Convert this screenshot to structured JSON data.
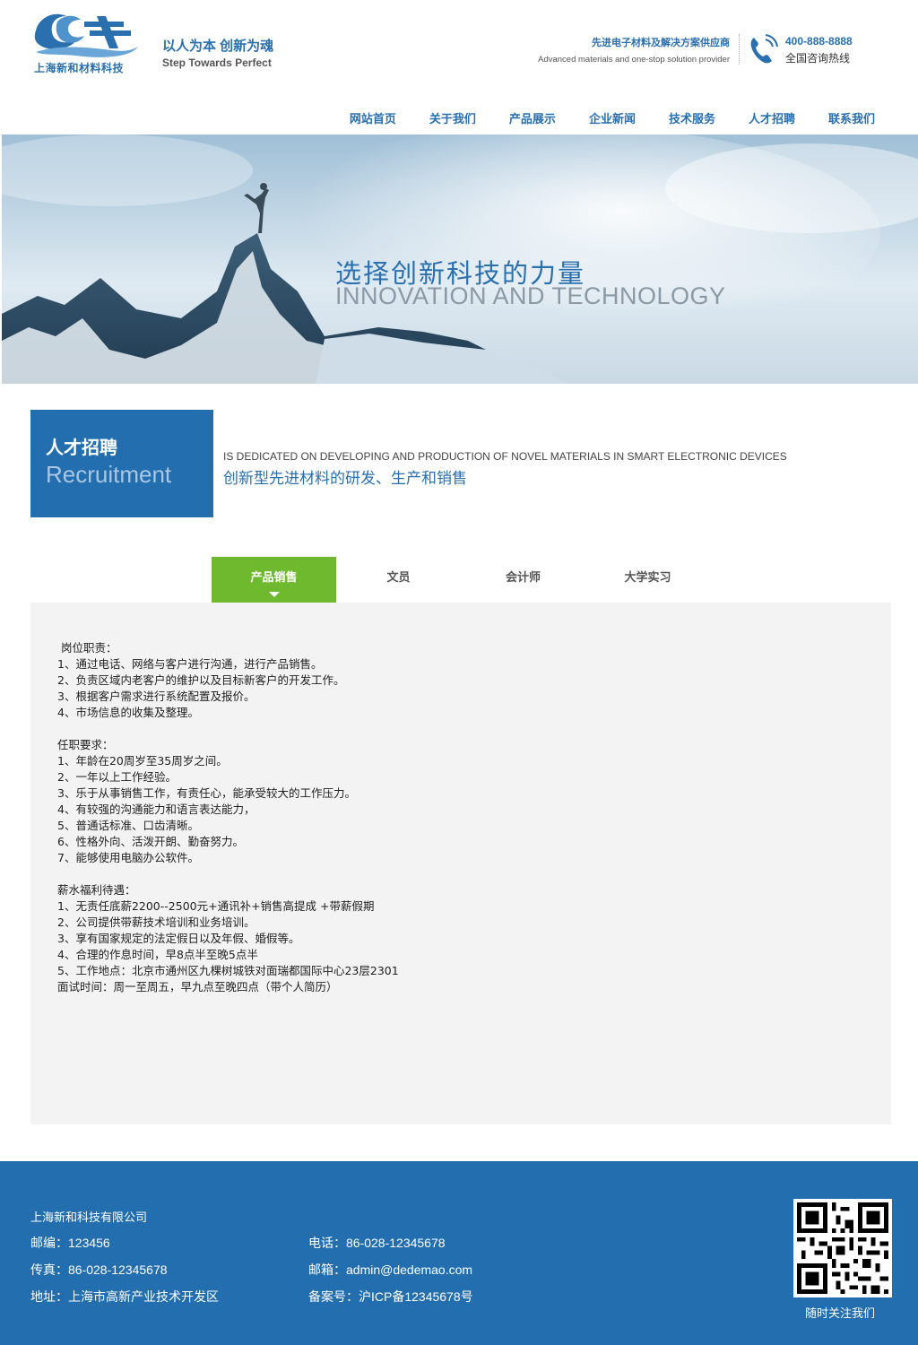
{
  "header": {
    "logo_text": "上海新和材料科技",
    "slogan_cn": "以人为本 创新为魂",
    "slogan_en": "Step Towards Perfect",
    "tagline_cn": "先进电子材料及解决方案供应商",
    "tagline_en": "Advanced materials and one-stop solution provider",
    "hotline_number": "400-888-8888",
    "hotline_label": "全国咨询热线"
  },
  "nav": {
    "items": [
      {
        "label": "网站首页"
      },
      {
        "label": "关于我们"
      },
      {
        "label": "产品展示"
      },
      {
        "label": "企业新闻"
      },
      {
        "label": "技术服务"
      },
      {
        "label": "人才招聘"
      },
      {
        "label": "联系我们"
      }
    ]
  },
  "banner": {
    "title_cn": "选择创新科技的力量",
    "title_en": "INNOVATION AND TECHNOLOGY"
  },
  "section": {
    "title_cn": "人才招聘",
    "title_en": "Recruitment",
    "desc_en": "IS DEDICATED ON DEVELOPING AND PRODUCTION OF NOVEL MATERIALS IN SMART ELECTRONIC DEVICES",
    "desc_cn": "创新型先进材料的研发、生产和销售"
  },
  "tabs": [
    {
      "label": "产品销售",
      "active": true
    },
    {
      "label": "文员",
      "active": false
    },
    {
      "label": "会计师",
      "active": false
    },
    {
      "label": "大学实习",
      "active": false
    }
  ],
  "content": {
    "duty_title": " 岗位职责：",
    "duties": [
      "1、通过电话、网络与客户进行沟通，进行产品销售。",
      "2、负责区域内老客户的维护以及目标新客户的开发工作。",
      "3、根据客户需求进行系统配置及报价。",
      "4、市场信息的收集及整理。"
    ],
    "req_title": "任职要求：",
    "requirements": [
      "1、年龄在20周岁至35周岁之间。",
      "2、一年以上工作经验。",
      "3、乐于从事销售工作，有责任心，能承受较大的工作压力。",
      "4、有较强的沟通能力和语言表达能力，",
      "5、普通话标准、口齿清晰。",
      "6、性格外向、活泼开朗、勤奋努力。",
      "7、能够使用电脑办公软件。"
    ],
    "benefit_title": "薪水福利待遇：",
    "benefits": [
      "1、无责任底薪2200--2500元+通讯补+销售高提成 +带薪假期",
      "2、公司提供带薪技术培训和业务培训。",
      "3、享有国家规定的法定假日以及年假、婚假等。",
      "4、合理的作息时间，早8点半至晚5点半",
      "5、工作地点：北京市通州区九棵树城铁对面瑞都国际中心23层2301",
      "面试时间：周一至周五，早九点至晚四点（带个人简历）"
    ]
  },
  "footer": {
    "company": "上海新和科技有限公司",
    "postcode": "邮编：123456",
    "phone": "电话：86-028-12345678",
    "fax": "传真：86-028-12345678",
    "email": "邮箱：admin@dedemao.com",
    "address": "地址：上海市高新产业技术开发区",
    "icp": "备案号：沪ICP备12345678号",
    "qr_label": "随时关注我们"
  },
  "colors": {
    "brand_blue": "#236eaf",
    "tab_active_green": "#6fb92e",
    "content_bg": "#f3f3f3"
  }
}
